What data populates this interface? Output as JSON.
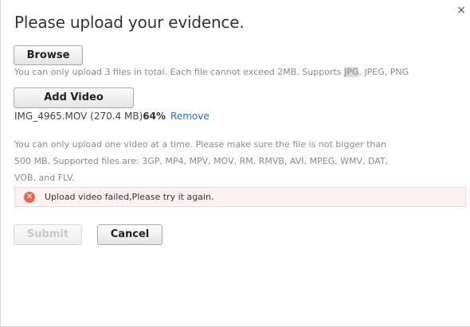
{
  "dialog": {
    "title": "Please upload your evidence.",
    "close_icon": "×"
  },
  "browse": {
    "label": "Browse",
    "help_before": "You can only upload 3 files in total. Each file cannot exceed 2MB. Supports ",
    "help_highlight": "JPG",
    "help_after": ", JPEG, PNG"
  },
  "video": {
    "add_label": "Add Video",
    "file_name": "IMG_4965.MOV (270.4 MB)",
    "progress": "64%",
    "remove_label": "Remove",
    "help": "You can only upload one video at a time. Please make sure the file is not bigger than 500 MB. Supported files are: 3GP, MP4, MPV, MOV, RM, RMVB, AVI, MPEG, WMV, DAT, VOB, and FLV."
  },
  "error": {
    "icon": "✕",
    "message": "Upload video failed,Please try it again."
  },
  "actions": {
    "submit_label": "Submit",
    "cancel_label": "Cancel"
  },
  "colors": {
    "link": "#2a6cc0",
    "error_bg": "#fdf2f2",
    "error_icon": "#e26a55"
  }
}
